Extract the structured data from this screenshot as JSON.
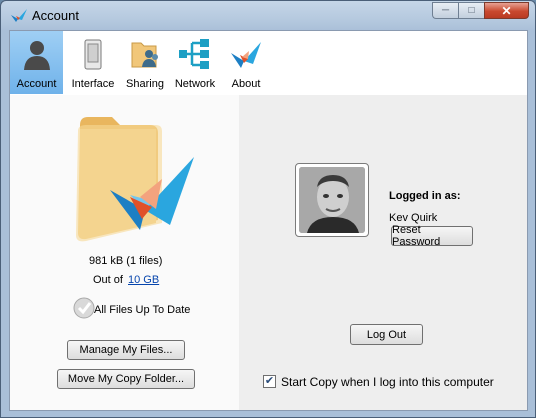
{
  "window": {
    "title": "Account"
  },
  "toolbar": {
    "items": [
      {
        "label": "Account",
        "icon": "user-icon",
        "active": true
      },
      {
        "label": "Interface",
        "icon": "phone-icon",
        "active": false
      },
      {
        "label": "Sharing",
        "icon": "shared-folder-icon",
        "active": false
      },
      {
        "label": "Network",
        "icon": "network-icon",
        "active": false
      },
      {
        "label": "About",
        "icon": "copy-logo-icon",
        "active": false
      }
    ]
  },
  "account": {
    "usage": "981 kB (1 files)",
    "out_of_prefix": "Out of",
    "quota_link": "10 GB",
    "status": "All Files Up To Date",
    "manage_button": "Manage My Files...",
    "move_button": "Move My Copy Folder..."
  },
  "user": {
    "logged_in_label": "Logged in as:",
    "name": "Kev Quirk",
    "reset_button": "Reset Password",
    "logout_button": "Log Out",
    "start_on_login_label": "Start Copy when I log into this computer",
    "start_on_login_checked": true
  },
  "colors": {
    "active_tab": "#6fb2ea",
    "link": "#0645ad"
  }
}
